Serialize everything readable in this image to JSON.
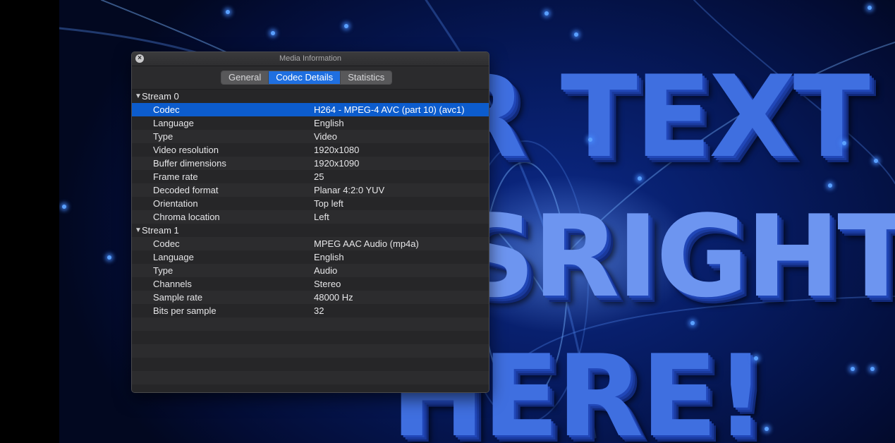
{
  "window": {
    "title": "Media Information",
    "close_icon": "close-icon"
  },
  "tabs": [
    {
      "label": "General",
      "active": false
    },
    {
      "label": "Codec Details",
      "active": true
    },
    {
      "label": "Statistics",
      "active": false
    }
  ],
  "streams": [
    {
      "label": "Stream 0",
      "rows": [
        {
          "key": "Codec",
          "value": "H264 - MPEG-4 AVC (part 10) (avc1)"
        },
        {
          "key": "Language",
          "value": "English"
        },
        {
          "key": "Type",
          "value": "Video"
        },
        {
          "key": "Video resolution",
          "value": "1920x1080"
        },
        {
          "key": "Buffer dimensions",
          "value": "1920x1090"
        },
        {
          "key": "Frame rate",
          "value": "25"
        },
        {
          "key": "Decoded format",
          "value": "Planar 4:2:0 YUV"
        },
        {
          "key": "Orientation",
          "value": "Top left"
        },
        {
          "key": "Chroma location",
          "value": "Left"
        }
      ]
    },
    {
      "label": "Stream 1",
      "rows": [
        {
          "key": "Codec",
          "value": "MPEG AAC Audio (mp4a)"
        },
        {
          "key": "Language",
          "value": "English"
        },
        {
          "key": "Type",
          "value": "Audio"
        },
        {
          "key": "Channels",
          "value": "Stereo"
        },
        {
          "key": "Sample rate",
          "value": "48000 Hz"
        },
        {
          "key": "Bits per sample",
          "value": "32"
        }
      ]
    }
  ],
  "background_video": {
    "lines": [
      "R TEXT",
      "SRIGHT",
      "HERE!"
    ]
  },
  "colors": {
    "selection": "#0c5ccd",
    "tab_active": "#1f6fe0",
    "panel_bg": "#262628"
  }
}
